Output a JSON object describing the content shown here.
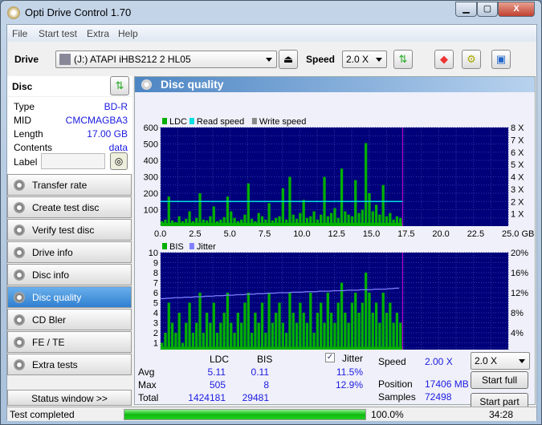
{
  "window": {
    "title": "Opti Drive Control 1.70"
  },
  "menu": [
    "File",
    "Start test",
    "Extra",
    "Help"
  ],
  "toolbar": {
    "drive_label": "Drive",
    "drive_value": "(J:)   ATAPI iHBS212   2 HL05",
    "speed_label": "Speed",
    "speed_value": "2.0 X"
  },
  "disc": {
    "header": "Disc",
    "fields": [
      {
        "k": "Type",
        "v": "BD-R"
      },
      {
        "k": "MID",
        "v": "CMCMAGBA3"
      },
      {
        "k": "Length",
        "v": "17.00 GB"
      },
      {
        "k": "Contents",
        "v": "data"
      }
    ],
    "label_key": "Label",
    "label_value": ""
  },
  "nav": [
    "Transfer rate",
    "Create test disc",
    "Verify test disc",
    "Drive info",
    "Disc info",
    "Disc quality",
    "CD Bler",
    "FE / TE",
    "Extra tests"
  ],
  "nav_selected": "Disc quality",
  "status_window": "Status window >>",
  "panel": {
    "title": "Disc quality"
  },
  "colors": {
    "ldc": "#00b000",
    "bis": "#00b000",
    "read": "#00e0e0",
    "write": "#888888",
    "jitter": "#8080ff",
    "plot_bg": "#00007a",
    "marker": "#d000d0"
  },
  "chart_data": [
    {
      "type": "bar",
      "legend": [
        "LDC",
        "Read speed",
        "Write speed"
      ],
      "legend_placement": "top-left",
      "xlim": [
        0,
        25
      ],
      "ylim": [
        0,
        600
      ],
      "y2lim": [
        0,
        8
      ],
      "xticks": [
        "0.0",
        "2.5",
        "5.0",
        "7.5",
        "10.0",
        "12.5",
        "15.0",
        "17.5",
        "20.0",
        "22.5",
        "25.0 GB"
      ],
      "yticks": [
        "100",
        "200",
        "300",
        "400",
        "500",
        "600"
      ],
      "y2ticks": [
        "1 X",
        "2 X",
        "3 X",
        "4 X",
        "5 X",
        "6 X",
        "7 X",
        "8 X"
      ],
      "x_end": 17.4,
      "read_speed_x": 2.0,
      "ldc": [
        30,
        40,
        180,
        35,
        25,
        60,
        30,
        45,
        90,
        30,
        50,
        200,
        40,
        35,
        60,
        120,
        30,
        40,
        55,
        180,
        90,
        50,
        30,
        40,
        70,
        260,
        45,
        30,
        80,
        60,
        40,
        140,
        35,
        50,
        60,
        230,
        40,
        300,
        70,
        45,
        80,
        160,
        50,
        60,
        90,
        40,
        70,
        300,
        60,
        80,
        110,
        50,
        350,
        90,
        70,
        60,
        280,
        80,
        100,
        505,
        200,
        90,
        130,
        70,
        250,
        60,
        80,
        40,
        60,
        50
      ]
    },
    {
      "type": "bar",
      "legend": [
        "BIS",
        "Jitter"
      ],
      "legend_placement": "top-left",
      "xlim": [
        0,
        25
      ],
      "ylim": [
        0,
        10
      ],
      "y2lim": [
        0,
        20
      ],
      "xticks": [
        "0.0",
        "2.5",
        "5.0",
        "7.5",
        "10.0",
        "12.5",
        "15.0",
        "17.5",
        "20.0",
        "22.5",
        "25.0 GB"
      ],
      "yticks": [
        "1",
        "2",
        "3",
        "4",
        "5",
        "6",
        "7",
        "8",
        "9",
        "10"
      ],
      "y2ticks": [
        "4%",
        "8%",
        "12%",
        "16%",
        "20%"
      ],
      "bis": [
        1,
        2,
        5,
        3,
        2,
        4,
        1,
        3,
        5,
        2,
        3,
        6,
        2,
        4,
        3,
        5,
        2,
        3,
        4,
        6,
        3,
        2,
        4,
        3,
        5,
        6,
        2,
        4,
        3,
        5,
        2,
        6,
        3,
        4,
        5,
        3,
        2,
        6,
        4,
        3,
        5,
        4,
        3,
        6,
        2,
        4,
        5,
        3,
        6,
        4,
        3,
        5,
        7,
        4,
        3,
        5,
        6,
        4,
        5,
        8,
        6,
        4,
        5,
        3,
        6,
        4,
        5,
        3,
        4,
        3
      ],
      "jitter": [
        10.8,
        10.8,
        10.9,
        10.9,
        11.0,
        11.0,
        11.0,
        11.1,
        11.1,
        11.1,
        11.2,
        11.2,
        11.2,
        11.3,
        11.3,
        11.3,
        11.4,
        11.4,
        11.4,
        11.5,
        11.5,
        11.5,
        11.6,
        11.6,
        11.6,
        11.7,
        11.7,
        11.7,
        11.8,
        11.8,
        11.8,
        11.9,
        11.9,
        11.9,
        12.0,
        12.0,
        12.0,
        12.0,
        12.1,
        12.1,
        12.1,
        12.1,
        12.2,
        12.2,
        12.2,
        12.2,
        12.3,
        12.3,
        12.3,
        12.3,
        12.4,
        12.4,
        12.4,
        12.4,
        12.5,
        12.5,
        12.5,
        12.5,
        12.6,
        12.6,
        12.6,
        12.6,
        12.7,
        12.7,
        12.7,
        12.7,
        12.8,
        12.8,
        12.9,
        12.9
      ]
    }
  ],
  "stats": {
    "col_ldc": "LDC",
    "col_bis": "BIS",
    "jitter_label": "Jitter",
    "jitter_checked": true,
    "rows": [
      {
        "k": "Avg",
        "ldc": "5.11",
        "bis": "0.11",
        "jit": "11.5%"
      },
      {
        "k": "Max",
        "ldc": "505",
        "bis": "8",
        "jit": "12.9%"
      },
      {
        "k": "Total",
        "ldc": "1424181",
        "bis": "29481",
        "jit": ""
      }
    ],
    "speed_label": "Speed",
    "speed_value": "2.00 X",
    "position_label": "Position",
    "position_value": "17406 MB",
    "samples_label": "Samples",
    "samples_value": "72498",
    "speed_select": "2.0 X",
    "start_full": "Start full",
    "start_part": "Start part"
  },
  "statusbar": {
    "text": "Test completed",
    "progress": 100.0,
    "progress_text": "100.0%",
    "time": "34:28"
  }
}
